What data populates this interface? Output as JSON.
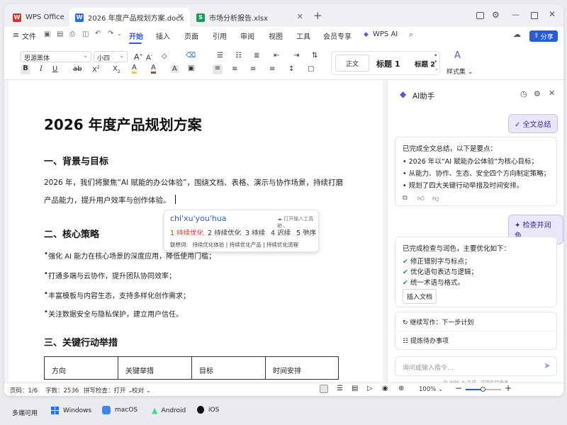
{
  "app": {
    "name": "WPS Office"
  },
  "tabs": [
    {
      "label": "2026 年度产品规划方案.docx",
      "type": "W"
    },
    {
      "label": "市场分析报告.xlsx",
      "type": "S"
    }
  ],
  "menubar": {
    "file": "文件",
    "items": [
      "开始",
      "插入",
      "页面",
      "引用",
      "审阅",
      "视图",
      "工具",
      "会员专享",
      "WPS AI"
    ],
    "active": "开始",
    "share": "分享"
  },
  "toolbar": {
    "font": "思源黑体",
    "size": "小四",
    "styles": [
      "正文",
      "标题 1",
      "标题 2"
    ],
    "style_set": "样式集"
  },
  "document": {
    "title": "2026 年度产品规划方案",
    "sections": [
      {
        "heading": "一、背景与目标"
      },
      {
        "heading": "二、核心策略"
      },
      {
        "heading": "三、关键行动举措"
      }
    ],
    "para1_line1": "2026 年，我们将聚焦“AI 赋能的办公体验”，围绕文档、表格、演示与协作场景，持续打磨",
    "para1_line2": "产品能力，提升用户效率与创作体验。",
    "bullets": [
      "强化 AI 能力在核心场景的深度应用，降低使用门槛；",
      "打通多端与云协作，提升团队协同效率；",
      "丰富模板与内容生态，支持多样化创作需求；",
      "关注数据安全与隐私保护，建立用户信任。"
    ],
    "table_headers": [
      "方向",
      "关键举措",
      "目标",
      "时间安排"
    ]
  },
  "ime": {
    "pinyin": "chi'xu'you'hua",
    "toolbox": "打开输入工具箱",
    "candidates": [
      "1 持续优化",
      "2 持续优化",
      "3 持续",
      "4 迟续",
      "5 弛序"
    ],
    "assoc_label": "联想词:",
    "assoc": [
      "持续优化体验",
      "持续优化产品",
      "持续优化流程"
    ]
  },
  "assistant": {
    "title": "AI助手",
    "btn_summary": "全文总结",
    "summary_intro": "已完成全文总结，以下是要点：",
    "summary_points": [
      "2026 年以“AI 赋能办公体验”为核心目标；",
      "从能力、协作、生态、安全四个方向制定策略；",
      "规划了四大关键行动举措及时间安排。"
    ],
    "btn_check": "检查并润色",
    "check_intro": "已完成检查与润色，主要优化如下：",
    "check_points": [
      "修正错别字与标点；",
      "优化语句表达与逻辑；",
      "统一术语与格式。"
    ],
    "insert_btn": "插入文档",
    "suggest1": "继续写作：下一步计划",
    "suggest2": "提炼待办事项",
    "input_placeholder": "询问或输入指令...",
    "footer": "由 WPS AI 生成，内容仅供参考"
  },
  "status": {
    "page": "页码：1/6",
    "words": "字数：2536",
    "spell": "拼写检查：打开",
    "proof": "校对",
    "zoom": "100%"
  },
  "platforms": {
    "label": "多端可用",
    "items": [
      "Windows",
      "macOS",
      "Android",
      "iOS"
    ]
  },
  "colors": {
    "accent": "#2a5bd7",
    "wps_red": "#d9302b",
    "word_blue": "#2b6de8",
    "sheet_green": "#1d9a57",
    "ai_purple": "#6b4ee6"
  }
}
